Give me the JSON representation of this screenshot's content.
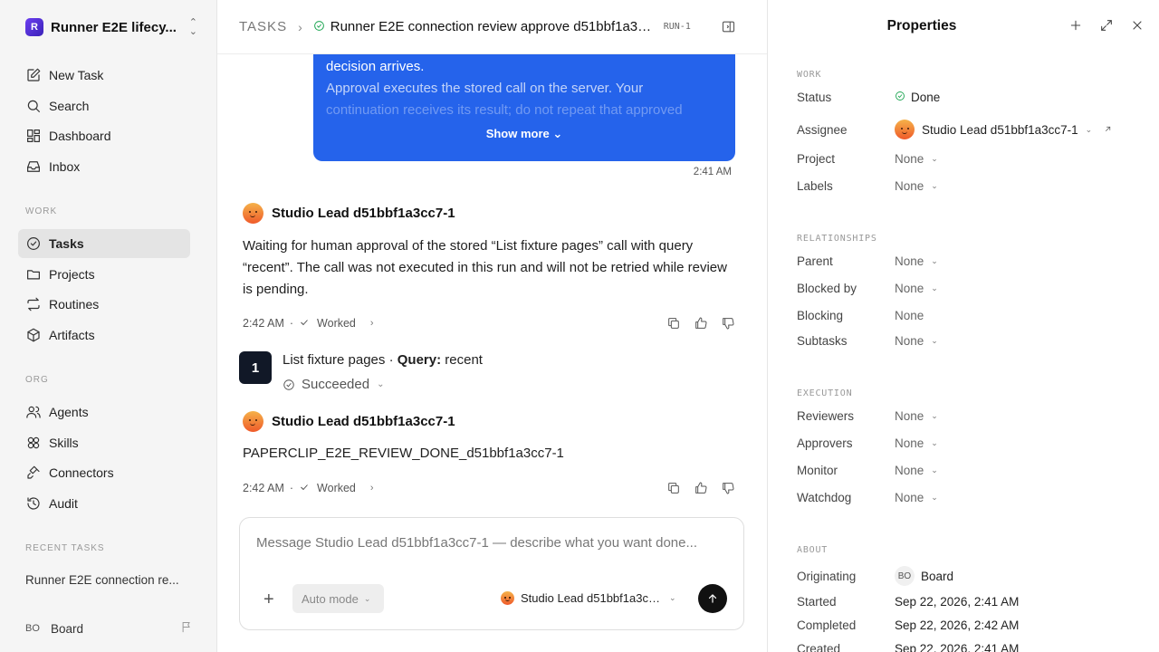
{
  "workspace": {
    "logo": "R",
    "name": "Runner E2E lifecy..."
  },
  "nav": {
    "primary": [
      {
        "label": "New Task",
        "icon": "new-task-icon"
      },
      {
        "label": "Search",
        "icon": "search-icon"
      },
      {
        "label": "Dashboard",
        "icon": "dashboard-icon"
      },
      {
        "label": "Inbox",
        "icon": "inbox-icon"
      }
    ],
    "work_label": "WORK",
    "work": [
      {
        "label": "Tasks",
        "icon": "tasks-icon",
        "active": true
      },
      {
        "label": "Projects",
        "icon": "folder-icon"
      },
      {
        "label": "Routines",
        "icon": "repeat-icon"
      },
      {
        "label": "Artifacts",
        "icon": "box-icon"
      }
    ],
    "org_label": "ORG",
    "org": [
      {
        "label": "Agents",
        "icon": "users-icon"
      },
      {
        "label": "Skills",
        "icon": "skills-icon"
      },
      {
        "label": "Connectors",
        "icon": "plug-icon"
      },
      {
        "label": "Audit",
        "icon": "history-icon"
      }
    ],
    "recent_label": "RECENT TASKS",
    "recent": [
      "Runner E2E connection re..."
    ],
    "user": {
      "initials": "BO",
      "name": "Board"
    }
  },
  "header": {
    "root": "TASKS",
    "title": "Runner E2E connection review approve d51bbf1a3cc...",
    "run": "RUN-1"
  },
  "thread": {
    "bubble_lines": [
      "decision arrives.",
      "Approval executes the stored call on the server. Your",
      "continuation receives its result; do not repeat that approved"
    ],
    "show_more": "Show more",
    "bubble_time": "2:41 AM",
    "message1": {
      "author": "Studio Lead d51bbf1a3cc7-1",
      "text": "Waiting for human approval of the stored “List fixture pages” call with query “recent”. The call was not executed in this run and will not be retried while review is pending.",
      "time": "2:42 AM",
      "status": "Worked"
    },
    "tool": {
      "number": "1",
      "name": "List fixture pages",
      "sep": "·",
      "query_label": "Query:",
      "query_value": "recent",
      "status": "Succeeded"
    },
    "message2": {
      "author": "Studio Lead d51bbf1a3cc7-1",
      "text": "PAPERCLIP_E2E_REVIEW_DONE_d51bbf1a3cc7-1",
      "time": "2:42 AM",
      "status": "Worked"
    },
    "dot": "·"
  },
  "composer": {
    "placeholder": "Message Studio Lead d51bbf1a3cc7-1 — describe what you want done...",
    "mode": "Auto mode",
    "agent": "Studio Lead d51bbf1a3cc..."
  },
  "properties": {
    "title": "Properties",
    "work_label": "WORK",
    "status_label": "Status",
    "status_value": "Done",
    "assignee_label": "Assignee",
    "assignee_value": "Studio Lead d51bbf1a3cc7-1",
    "project_label": "Project",
    "project_value": "None",
    "labels_label": "Labels",
    "labels_value": "None",
    "relationships_label": "RELATIONSHIPS",
    "parent_label": "Parent",
    "parent_value": "None",
    "blocked_by_label": "Blocked by",
    "blocked_by_value": "None",
    "blocking_label": "Blocking",
    "blocking_value": "None",
    "subtasks_label": "Subtasks",
    "subtasks_value": "None",
    "execution_label": "EXECUTION",
    "reviewers_label": "Reviewers",
    "reviewers_value": "None",
    "approvers_label": "Approvers",
    "approvers_value": "None",
    "monitor_label": "Monitor",
    "monitor_value": "None",
    "watchdog_label": "Watchdog",
    "watchdog_value": "None",
    "about_label": "ABOUT",
    "originating_label": "Originating",
    "originating_initials": "BO",
    "originating_value": "Board",
    "started_label": "Started",
    "started_value": "Sep 22, 2026, 2:41 AM",
    "completed_label": "Completed",
    "completed_value": "Sep 22, 2026, 2:42 AM",
    "created_label": "Created",
    "created_value": "Sep 22, 2026, 2:41 AM"
  },
  "colors": {
    "accent": "#2563eb",
    "success": "#1ea653",
    "dark": "#111827"
  }
}
